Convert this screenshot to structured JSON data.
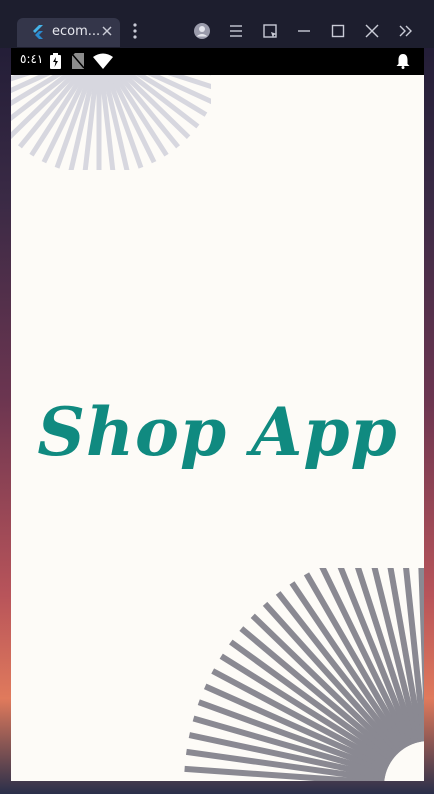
{
  "window": {
    "tab_title": "ecom...",
    "tab_icon": "flutter-icon"
  },
  "status_bar": {
    "time": "٥:٤١"
  },
  "app": {
    "title": "Shop App"
  },
  "colors": {
    "title": "#108a80",
    "background": "#fdfbf7",
    "deco_top": "#d7d7df",
    "deco_bottom": "#8a8992"
  }
}
